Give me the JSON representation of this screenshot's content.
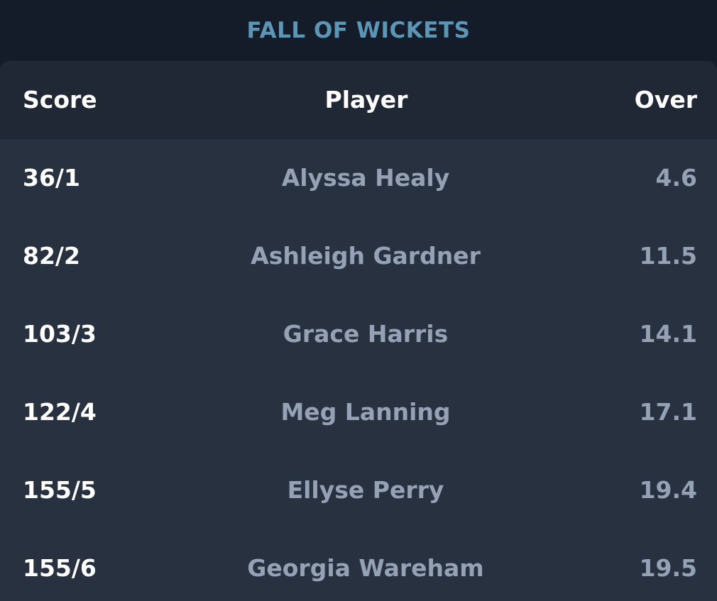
{
  "title": "FALL OF WICKETS",
  "columns": {
    "score": "Score",
    "player": "Player",
    "over": "Over"
  },
  "rows": [
    {
      "score": "36/1",
      "player": "Alyssa Healy",
      "over": "4.6"
    },
    {
      "score": "82/2",
      "player": "Ashleigh Gardner",
      "over": "11.5"
    },
    {
      "score": "103/3",
      "player": "Grace Harris",
      "over": "14.1"
    },
    {
      "score": "122/4",
      "player": "Meg Lanning",
      "over": "17.1"
    },
    {
      "score": "155/5",
      "player": "Ellyse Perry",
      "over": "19.4"
    },
    {
      "score": "155/6",
      "player": "Georgia Wareham",
      "over": "19.5"
    }
  ],
  "colors": {
    "background": "#141c29",
    "panel": "#283140",
    "header": "#202835",
    "title_accent": "#5d95b5",
    "primary_text": "#ffffff",
    "muted_text": "#95a1b5"
  }
}
